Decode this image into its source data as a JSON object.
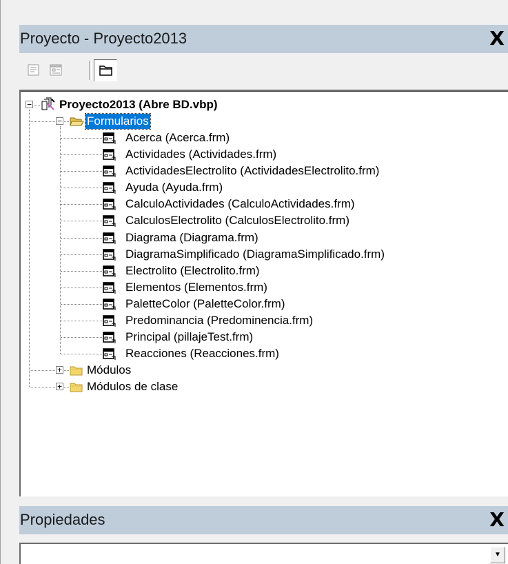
{
  "project_window": {
    "title": "Proyecto - Proyecto2013",
    "close_label": "X",
    "toolbar": [
      "view-code-icon",
      "view-object-icon",
      "toggle-folders-icon"
    ]
  },
  "tree": {
    "root": {
      "label": "Proyecto2013 (Abre BD.vbp)",
      "expanded": true
    },
    "folders": [
      {
        "label": "Formularios",
        "expanded": true,
        "selected": true,
        "items": [
          "Acerca (Acerca.frm)",
          "Actividades (Actividades.frm)",
          "ActividadesElectrolito (ActividadesElectrolito.frm)",
          "Ayuda (Ayuda.frm)",
          "CalculoActividades (CalculoActividades.frm)",
          "CalculosElectrolito (CalculosElectrolito.frm)",
          "Diagrama (Diagrama.frm)",
          "DiagramaSimplificado (DiagramaSimplificado.frm)",
          "Electrolito (Electrolito.frm)",
          "Elementos (Elementos.frm)",
          "PaletteColor (PaletteColor.frm)",
          "Predominancia (Predominencia.frm)",
          "Principal (pillajeTest.frm)",
          "Reacciones (Reacciones.frm)"
        ]
      },
      {
        "label": "Módulos",
        "expanded": false
      },
      {
        "label": "Módulos de clase",
        "expanded": false
      }
    ]
  },
  "properties_window": {
    "title": "Propiedades",
    "close_label": "X",
    "object_selector_value": ""
  },
  "colors": {
    "titlebar": "#bfcddb",
    "selection": "#0078d7",
    "folder_yellow": "#f5d66a"
  }
}
